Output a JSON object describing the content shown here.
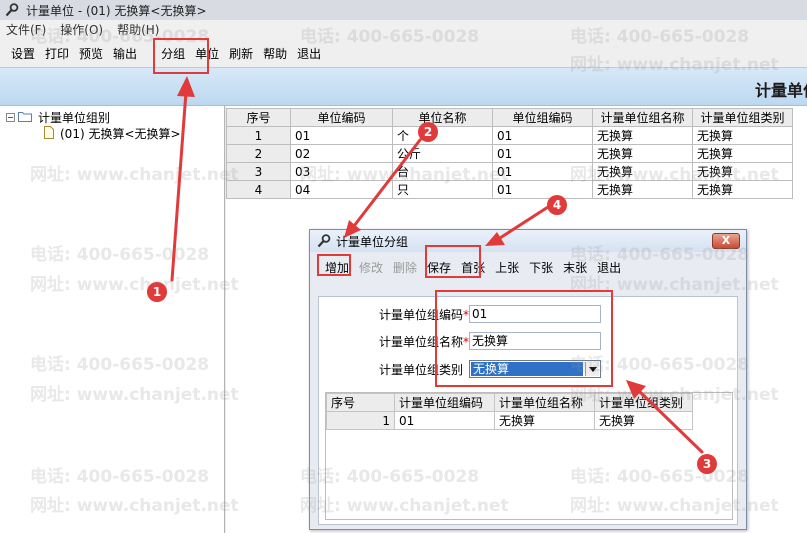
{
  "window": {
    "title": "计量单位 - (01) 无换算<无换算>"
  },
  "menu": [
    "文件(F)",
    "操作(O)",
    "帮助(H)"
  ],
  "toolbar": [
    "设置",
    "打印",
    "预览",
    "输出",
    "分组",
    "单位",
    "刷新",
    "帮助",
    "退出"
  ],
  "banner": {
    "title": "计量单位"
  },
  "tree": {
    "root": "计量单位组别",
    "child": "(01) 无换算<无换算>"
  },
  "grid": {
    "headers": [
      "序号",
      "单位编码",
      "单位名称",
      "单位组编码",
      "计量单位组名称",
      "计量单位组类别"
    ],
    "rows": [
      [
        "1",
        "01",
        "个",
        "01",
        "无换算",
        "无换算"
      ],
      [
        "2",
        "02",
        "公斤",
        "01",
        "无换算",
        "无换算"
      ],
      [
        "3",
        "03",
        "台",
        "01",
        "无换算",
        "无换算"
      ],
      [
        "4",
        "04",
        "只",
        "01",
        "无换算",
        "无换算"
      ]
    ]
  },
  "dialog": {
    "title": "计量单位分组",
    "close": "X",
    "toolbar": [
      "增加",
      "修改",
      "删除",
      "保存",
      "首张",
      "上张",
      "下张",
      "末张",
      "退出"
    ],
    "fields": {
      "code_label": "计量单位组编码",
      "code_value": "01",
      "name_label": "计量单位组名称",
      "name_value": "无换算",
      "type_label": "计量单位组类别",
      "type_value": "无换算",
      "required_mark": "*"
    },
    "grid": {
      "headers": [
        "序号",
        "计量单位组编码",
        "计量单位组名称",
        "计量单位组类别"
      ],
      "rows": [
        [
          "1",
          "01",
          "无换算",
          "无换算"
        ]
      ]
    }
  },
  "watermark": {
    "phone": "电话: 400-665-0028",
    "site": "网址: www.chanjet.net"
  },
  "annotations": {
    "badges": [
      "1",
      "2",
      "3",
      "4"
    ],
    "color": "#e03a3a"
  }
}
